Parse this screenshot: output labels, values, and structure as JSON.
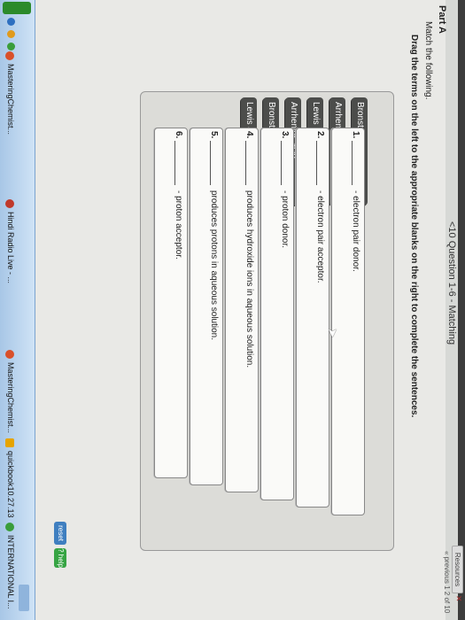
{
  "window": {
    "title": "<10 Question 1-6 - Matching",
    "resources_label": "Resources",
    "pager": "« previous 1 2 of 10"
  },
  "part": {
    "label": "Part A",
    "instruction": "Match the following.",
    "directions": "Drag the terms on the left to the appropriate blanks on the right to complete the sentences."
  },
  "terms": [
    {
      "label": "Bronsted-Lowry base"
    },
    {
      "label": "Arrhenius base"
    },
    {
      "label": "Lewis base"
    },
    {
      "label": "Arrhenius acid"
    },
    {
      "label": "Bronsted-Lowry acid"
    },
    {
      "label": "Lewis acid"
    }
  ],
  "sentences": [
    {
      "number": "1.",
      "text": "- electron pair donor."
    },
    {
      "number": "2.",
      "text": "- electron pair acceptor."
    },
    {
      "number": "3.",
      "text": "- proton donor."
    },
    {
      "number": "4.",
      "text": "produces hydroxide ions in aqueous solution."
    },
    {
      "number": "5.",
      "text": "produces protons in aqueous solution."
    },
    {
      "number": "6.",
      "text": "- proton acceptor."
    }
  ],
  "buttons": {
    "reset": "reset",
    "help": "? help"
  },
  "taskbar": {
    "items": [
      {
        "label": "MasteringChemist...",
        "color": "#d9502a"
      },
      {
        "label": "Hindi Radio Live - ...",
        "color": "#c0392b"
      },
      {
        "label": "MasteringChemist...",
        "color": "#d9502a"
      },
      {
        "label": "quickbook10.27.13",
        "color": "#e6a400"
      },
      {
        "label": "INTERNATIONAL I...",
        "color": "#3a9d3a"
      }
    ]
  },
  "colors": {
    "term_bg": "#4c4d4b",
    "page_bg": "#e9e9e6",
    "reset_btn": "#3f7fc0",
    "help_btn": "#36a443"
  }
}
